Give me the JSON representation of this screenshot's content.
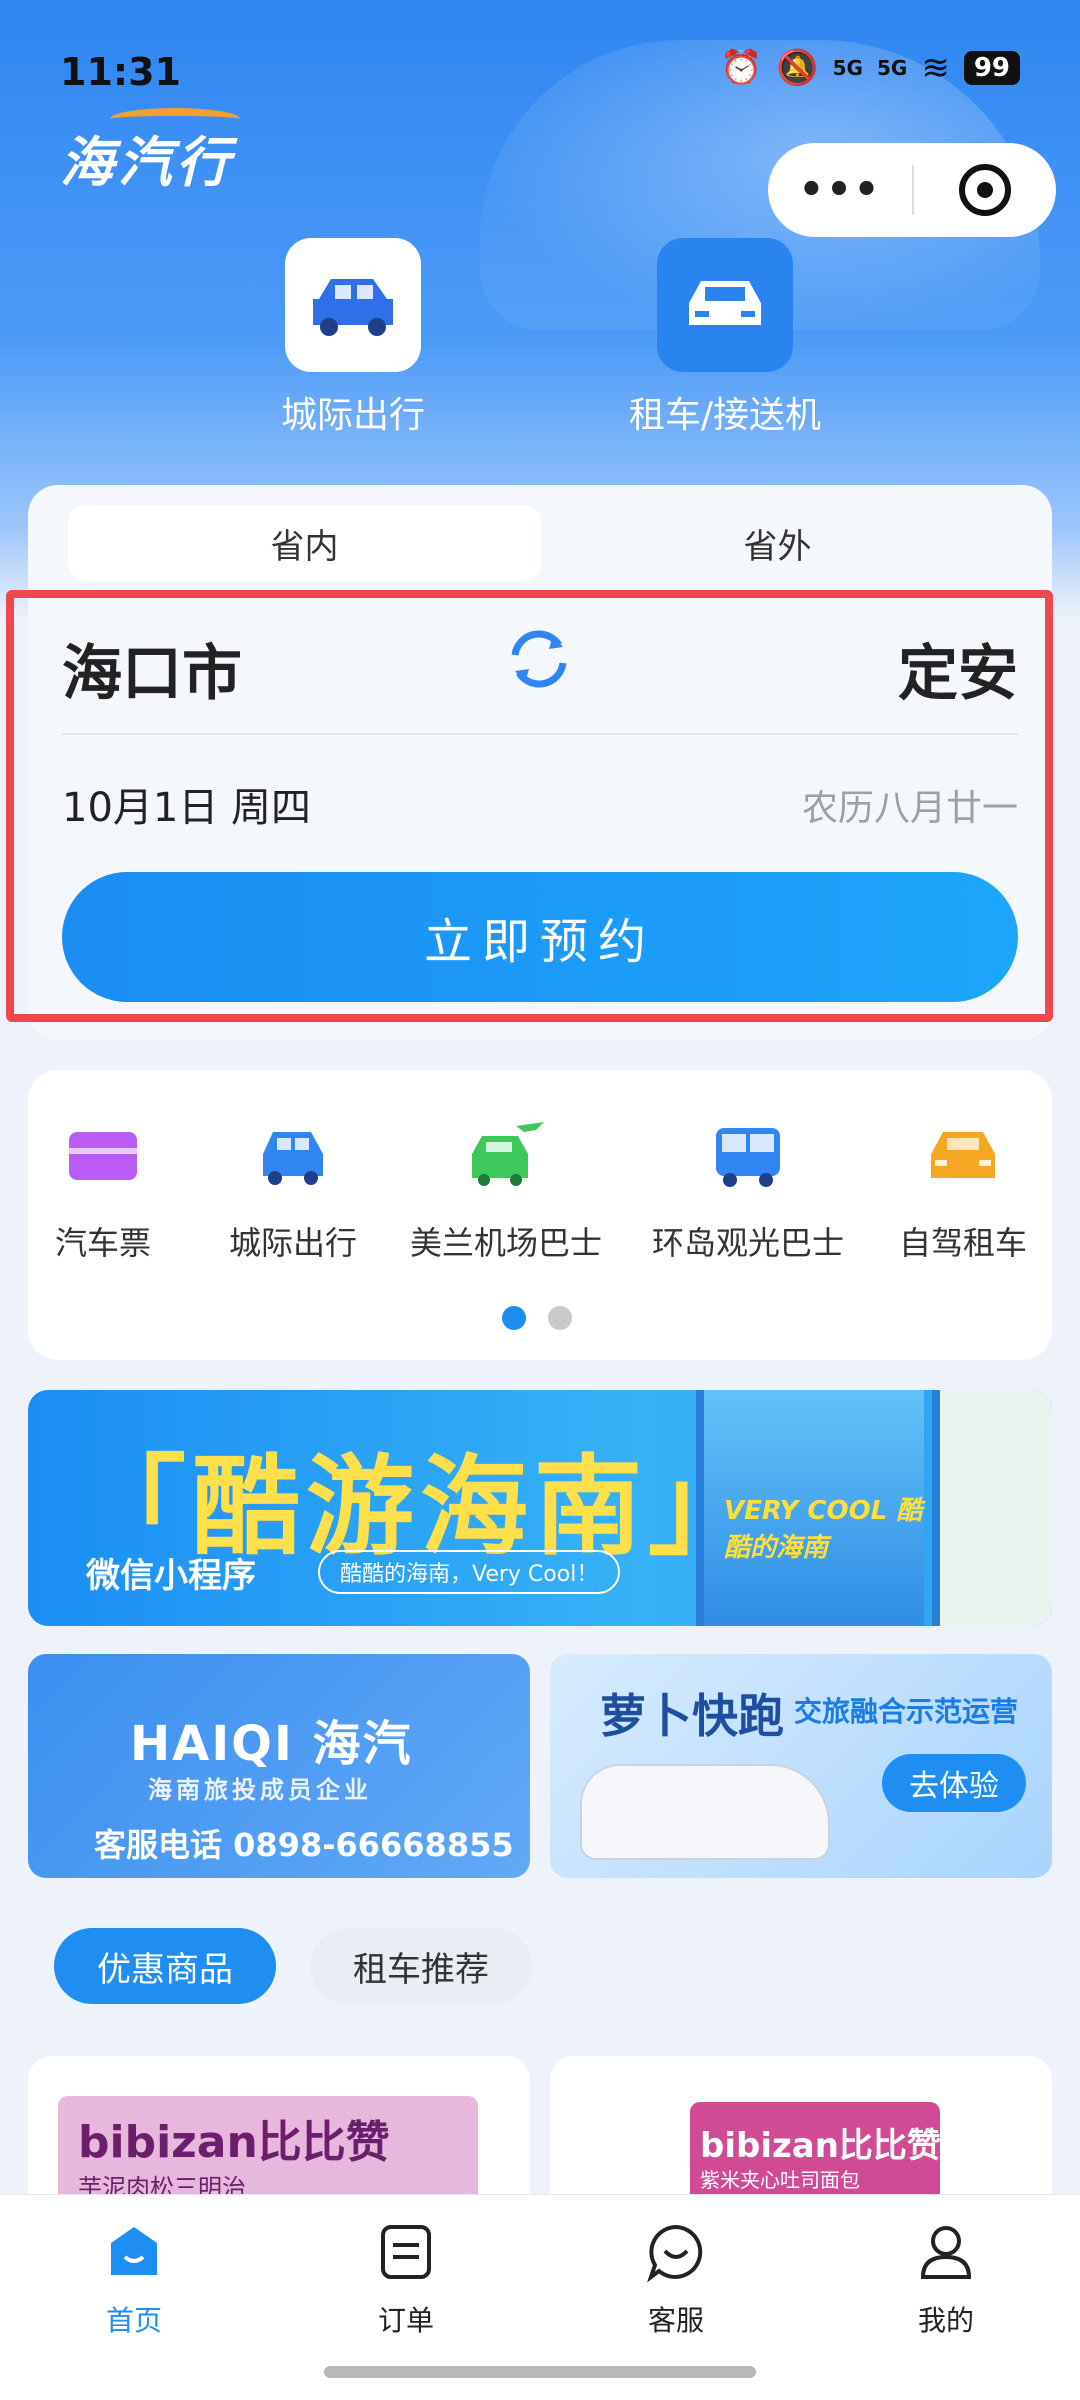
{
  "status_bar": {
    "time": "11:31",
    "network_1": "5G",
    "network_2": "5G",
    "battery": "99"
  },
  "app": {
    "logo_text": "海汽行"
  },
  "top_modes": [
    {
      "label": "城际出行",
      "icon": "car-icon"
    },
    {
      "label": "租车/接送机",
      "icon": "taxi-icon"
    }
  ],
  "booking": {
    "tabs": [
      {
        "label": "省内",
        "active": true
      },
      {
        "label": "省外",
        "active": false
      }
    ],
    "from_city": "海口市",
    "to_city": "定安",
    "date": "10月1日 周四",
    "lunar_date": "农历八月廿一",
    "book_button": "立即预约"
  },
  "services": [
    {
      "label": "汽车票",
      "icon": "ticket-icon",
      "color": "#b85cf5"
    },
    {
      "label": "城际出行",
      "icon": "car-icon",
      "color": "#2f86f2"
    },
    {
      "label": "美兰机场巴士",
      "icon": "airport-bus-icon",
      "color": "#3cc95a"
    },
    {
      "label": "环岛观光巴士",
      "icon": "bus-icon",
      "color": "#2f86f2"
    },
    {
      "label": "自驾租车",
      "icon": "rental-car-icon",
      "color": "#f5a623"
    }
  ],
  "banner": {
    "title": "「酷游海南」",
    "subtitle": "微信小程序",
    "pill": "酷酷的海南，Very Cool！",
    "phone_text": "VERY COOL 酷酷的海南"
  },
  "promo_left": {
    "brand": "HAIQI 海汽",
    "sub": "海南旅投成员企业",
    "hotline": "客服电话 0898-66668855"
  },
  "promo_right": {
    "title": "萝卜快跑",
    "sub": "交旅融合示范运营",
    "button": "去体验"
  },
  "chips": [
    {
      "label": "优惠商品",
      "active": true
    },
    {
      "label": "租车推荐",
      "active": false
    }
  ],
  "products": [
    {
      "brand": "bibizan比比赞",
      "flavor": "芋泥肉松三明治"
    },
    {
      "brand": "bibizan比比赞",
      "flavor": "紫米夹心吐司面包"
    }
  ],
  "tabbar": [
    {
      "label": "首页",
      "icon": "home-icon",
      "active": true
    },
    {
      "label": "订单",
      "icon": "order-icon",
      "active": false
    },
    {
      "label": "客服",
      "icon": "chat-icon",
      "active": false
    },
    {
      "label": "我的",
      "icon": "user-icon",
      "active": false
    }
  ],
  "colors": {
    "primary": "#1f8ef2",
    "highlight_border": "#f0474e",
    "banner_yellow": "#ffe04a"
  }
}
